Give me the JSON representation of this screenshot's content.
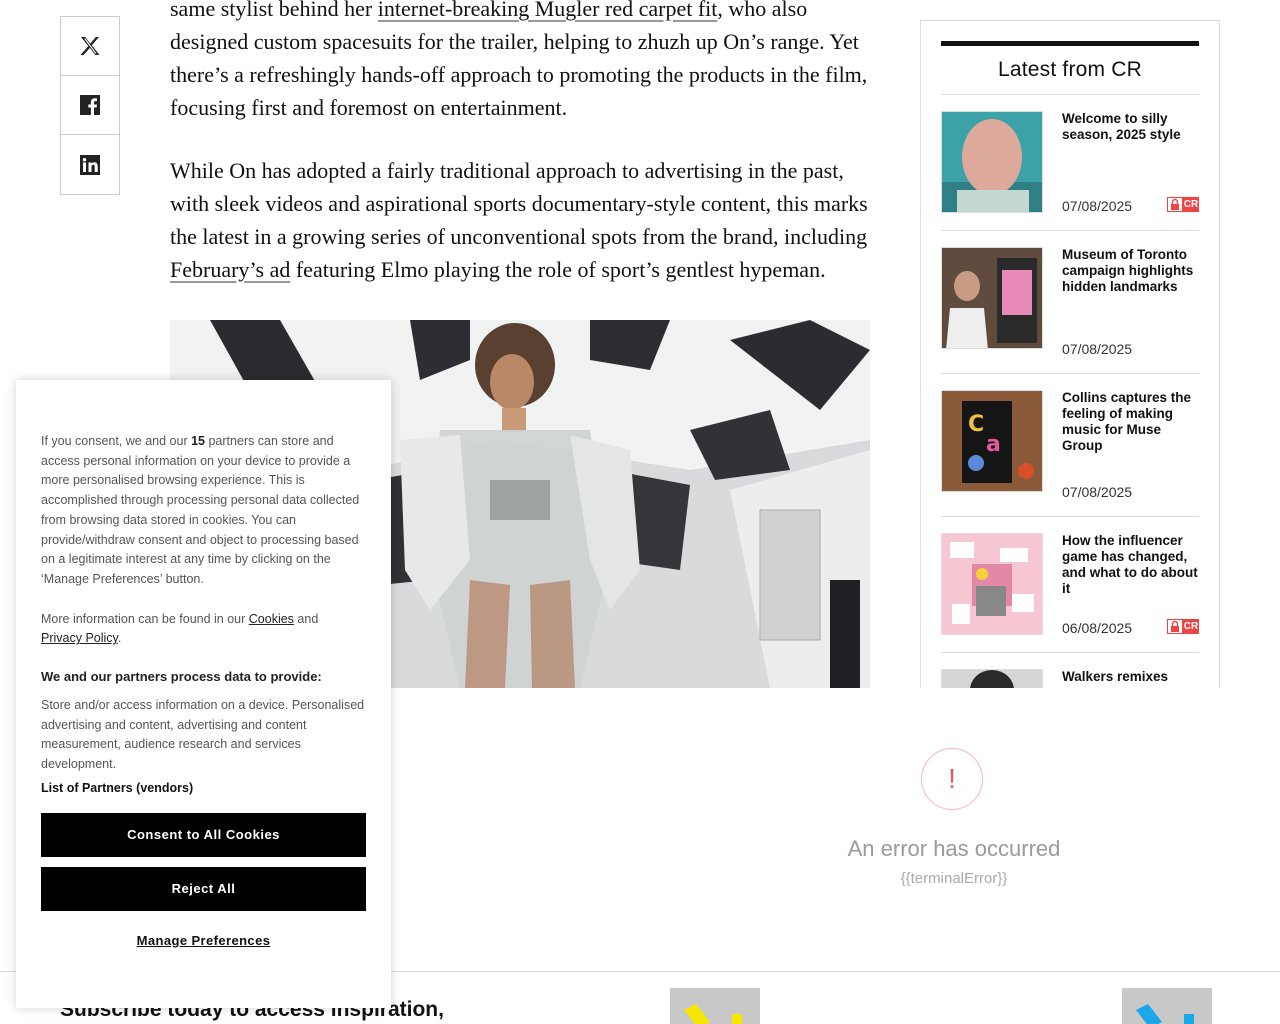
{
  "share": {
    "items": [
      {
        "icon": "x-twitter-icon"
      },
      {
        "icon": "facebook-icon"
      },
      {
        "icon": "linkedin-icon"
      }
    ]
  },
  "article": {
    "p1_pre": "same stylist behind her ",
    "p1_link": "internet-breaking Mugler red carpet fit",
    "p1_post": ", who also designed custom spacesuits for the trailer, helping to zhuzh up On’s range. Yet there’s a refreshingly hands-off approach to promoting the products in the film, focusing first and foremost on entertainment.",
    "p2_pre": "While On has adopted a fairly traditional approach to advertising in the past, with sleek videos and aspirational sports documentary-style content, this marks the latest in a growing series of unconventional spots from the brand, including ",
    "p2_link": "February’s ad",
    "p2_post": " featuring Elmo playing the role of sport’s gentlest hypeman."
  },
  "sidebar": {
    "title": "Latest from CR",
    "items": [
      {
        "title": "Welcome to silly season, 2025 style",
        "date": "07/08/2025",
        "locked": true
      },
      {
        "title": "Museum of Toronto campaign highlights hidden landmarks",
        "date": "07/08/2025",
        "locked": false
      },
      {
        "title": "Collins captures the feeling of making music for Muse Group",
        "date": "07/08/2025",
        "locked": false
      },
      {
        "title": "How the influencer game has changed, and what to do about it",
        "date": "06/08/2025",
        "locked": true
      },
      {
        "title": "Walkers remixes",
        "date": "",
        "locked": false
      }
    ],
    "badge_text": "CR"
  },
  "error": {
    "icon": "!",
    "title": "An error has occurred",
    "subtitle": "{{terminalError}}"
  },
  "footer": {
    "subscribe": "Subscribe today to access inspiration,"
  },
  "consent": {
    "p1_pre": "If you consent, we and our ",
    "p1_count": "15",
    "p1_post": " partners can store and access personal information on your device to provide a more personalised browsing experience. This is accomplished through processing personal data collected from browsing data stored in cookies. You can provide/withdraw consent and object to processing based on a legitimate interest at any time by clicking on the ‘Manage Preferences’ button.",
    "p2_pre": "More information can be found in our ",
    "cookies_link": "Cookies",
    "p2_mid": " and",
    "privacy_link": "Privacy Policy",
    "p2_post": ".",
    "heading": "We and our partners process data to provide:",
    "p3": "Store and/or access information on a device. Personalised advertising and content, advertising and content measurement, audience research and services development.",
    "vendors": "List of Partners (vendors)",
    "accept": "Consent to All Cookies",
    "reject": "Reject All",
    "manage": "Manage Preferences"
  }
}
